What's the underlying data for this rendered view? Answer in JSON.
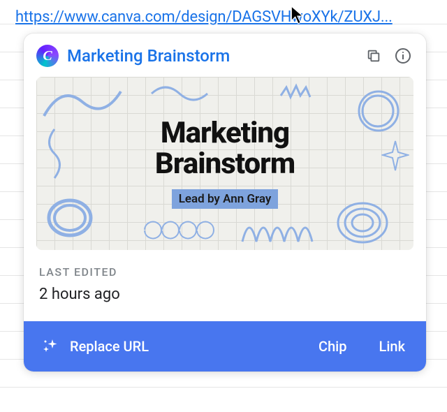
{
  "url": "https://www.canva.com/design/DAGSVHwoXYk/ZUXJ...",
  "popup": {
    "logo_letter": "C",
    "title": "Marketing Brainstorm",
    "thumbnail": {
      "heading_line1": "Marketing",
      "heading_line2": "Brainstorm",
      "subtitle": "Lead by Ann Gray"
    },
    "meta": {
      "label": "LAST EDITED",
      "value": "2 hours ago"
    },
    "actions": {
      "replace": "Replace URL",
      "chip": "Chip",
      "link": "Link"
    }
  },
  "icons": {
    "copy": "copy-icon",
    "info": "info-icon",
    "sparkle": "sparkle-icon"
  }
}
